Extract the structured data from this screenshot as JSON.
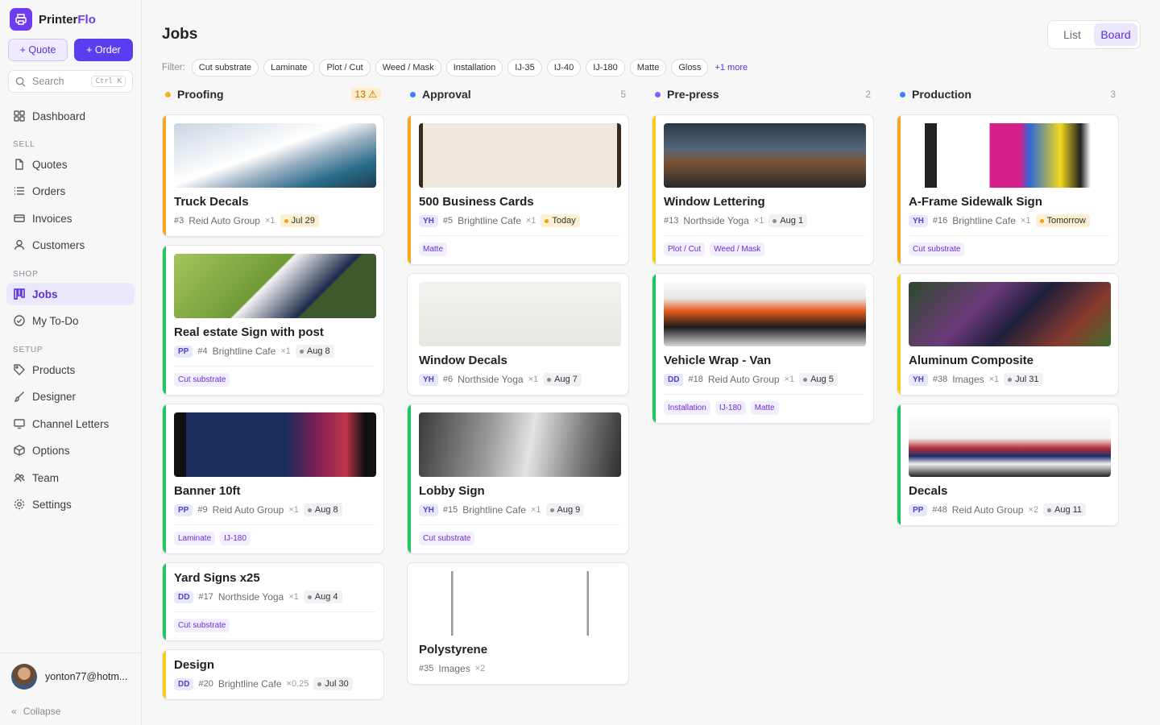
{
  "app": {
    "name_a": "Printer",
    "name_b": "Flo"
  },
  "actions": {
    "quote": "+ Quote",
    "order": "+ Order"
  },
  "search": {
    "placeholder": "Search",
    "shortcut": "Ctrl K"
  },
  "nav": {
    "dashboard": "Dashboard",
    "sell": "SELL",
    "quotes": "Quotes",
    "orders": "Orders",
    "invoices": "Invoices",
    "customers": "Customers",
    "shop": "SHOP",
    "jobs": "Jobs",
    "todo": "My To-Do",
    "setup": "SETUP",
    "products": "Products",
    "designer": "Designer",
    "channel": "Channel Letters",
    "options": "Options",
    "team": "Team",
    "settings": "Settings"
  },
  "user": {
    "email": "yonton77@hotm..."
  },
  "collapse": "Collapse",
  "page": {
    "title": "Jobs"
  },
  "view": {
    "list": "List",
    "board": "Board"
  },
  "filter": {
    "label": "Filter:",
    "chips": [
      "Cut substrate",
      "Laminate",
      "Plot / Cut",
      "Weed / Mask",
      "Installation",
      "IJ-35",
      "IJ-40",
      "IJ-180",
      "Matte",
      "Gloss"
    ],
    "more": "+1 more"
  },
  "colors": {
    "accent": "#5b3df0",
    "proofing": "#f5b41e",
    "approval": "#3b82f6",
    "prepress": "#8b5cf6",
    "production": "#3b82f6"
  },
  "columns": [
    {
      "name": "Proofing",
      "count": "13 ⚠",
      "cards": [
        {
          "title": "Truck Decals",
          "initials": "",
          "num": "#3",
          "customer": "Reid Auto Group",
          "qty": "×1",
          "date": "Jul 29",
          "hot": true,
          "tags": [],
          "stripe": "#f5a623"
        },
        {
          "title": "Real estate Sign with post",
          "initials": "PP",
          "num": "#4",
          "customer": "Brightline Cafe",
          "qty": "×1",
          "date": "Aug 8",
          "hot": false,
          "tags": [
            "Cut substrate"
          ],
          "stripe": "#22c55e"
        },
        {
          "title": "Banner 10ft",
          "initials": "PP",
          "num": "#9",
          "customer": "Reid Auto Group",
          "qty": "×1",
          "date": "Aug 8",
          "hot": false,
          "tags": [
            "Laminate",
            "IJ-180"
          ],
          "stripe": "#22c55e"
        },
        {
          "title": "Yard Signs x25",
          "initials": "DD",
          "num": "#17",
          "customer": "Northside Yoga",
          "qty": "×1",
          "date": "Aug 4",
          "hot": false,
          "tags": [
            "Cut substrate"
          ],
          "stripe": "#22c55e"
        },
        {
          "title": "Design",
          "initials": "DD",
          "num": "#20",
          "customer": "Brightline Cafe",
          "qty": "×0.25",
          "date": "Jul 30",
          "hot": false,
          "tags": [],
          "stripe": "#facc15"
        }
      ]
    },
    {
      "name": "Approval",
      "count": "5",
      "cards": [
        {
          "title": "500 Business Cards",
          "initials": "YH",
          "num": "#5",
          "customer": "Brightline Cafe",
          "qty": "×1",
          "date": "Today",
          "hot": true,
          "tags": [
            "Matte"
          ],
          "stripe": "#f5a623"
        },
        {
          "title": "Window Decals",
          "initials": "YH",
          "num": "#6",
          "customer": "Northside Yoga",
          "qty": "×1",
          "date": "Aug 7",
          "hot": false,
          "tags": [],
          "stripe": ""
        },
        {
          "title": "Lobby Sign",
          "initials": "YH",
          "num": "#15",
          "customer": "Brightline Cafe",
          "qty": "×1",
          "date": "Aug 9",
          "hot": false,
          "tags": [
            "Cut substrate"
          ],
          "stripe": "#22c55e"
        },
        {
          "title": "Polystyrene",
          "initials": "",
          "num": "#35",
          "customer": "Images",
          "qty": "×2",
          "date": "",
          "hot": false,
          "tags": [],
          "stripe": ""
        }
      ]
    },
    {
      "name": "Pre-press",
      "count": "2",
      "cards": [
        {
          "title": "Window Lettering",
          "initials": "",
          "num": "#13",
          "customer": "Northside Yoga",
          "qty": "×1",
          "date": "Aug 1",
          "hot": false,
          "tags": [
            "Plot / Cut",
            "Weed / Mask"
          ],
          "stripe": "#facc15"
        },
        {
          "title": "Vehicle Wrap - Van",
          "initials": "DD",
          "num": "#18",
          "customer": "Reid Auto Group",
          "qty": "×1",
          "date": "Aug 5",
          "hot": false,
          "tags": [
            "Installation",
            "IJ-180",
            "Matte"
          ],
          "stripe": "#22c55e"
        }
      ]
    },
    {
      "name": "Production",
      "count": "3",
      "cards": [
        {
          "title": "A-Frame Sidewalk Sign",
          "initials": "YH",
          "num": "#16",
          "customer": "Brightline Cafe",
          "qty": "×1",
          "date": "Tomorrow",
          "hot": true,
          "tags": [
            "Cut substrate"
          ],
          "stripe": "#f5a623"
        },
        {
          "title": "Aluminum Composite",
          "initials": "YH",
          "num": "#38",
          "customer": "Images",
          "qty": "×1",
          "date": "Jul 31",
          "hot": false,
          "tags": [],
          "stripe": "#facc15"
        },
        {
          "title": "Decals",
          "initials": "PP",
          "num": "#48",
          "customer": "Reid Auto Group",
          "qty": "×2",
          "date": "Aug 11",
          "hot": false,
          "tags": [],
          "stripe": "#22c55e"
        }
      ]
    }
  ]
}
